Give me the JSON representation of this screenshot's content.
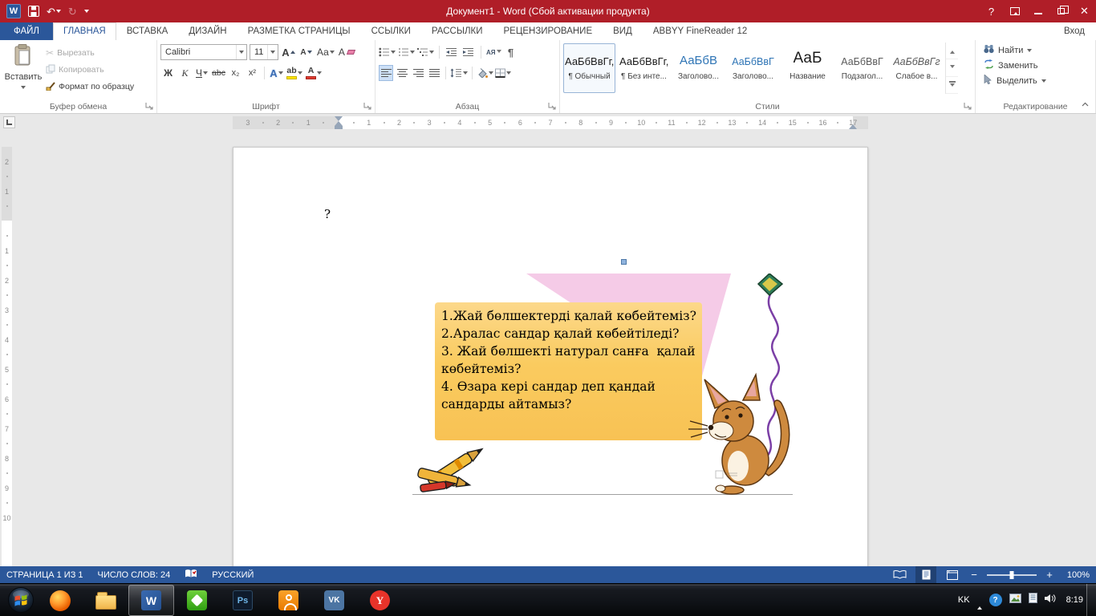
{
  "titlebar": {
    "title": "Документ1 -  Word (Сбой активации продукта)",
    "signin": "Вход"
  },
  "icons": {
    "undo": "↶",
    "redo": "↻",
    "close": "✕",
    "cut": "✂",
    "help": "?",
    "tray_help": "?"
  },
  "ribbon": {
    "tabs": [
      {
        "label": "ФАЙЛ",
        "class": "file"
      },
      {
        "label": "ГЛАВНАЯ",
        "class": "active"
      },
      {
        "label": "ВСТАВКА"
      },
      {
        "label": "ДИЗАЙН"
      },
      {
        "label": "РАЗМЕТКА СТРАНИЦЫ"
      },
      {
        "label": "ССЫЛКИ"
      },
      {
        "label": "РАССЫЛКИ"
      },
      {
        "label": "РЕЦЕНЗИРОВАНИЕ"
      },
      {
        "label": "ВИД"
      },
      {
        "label": "ABBYY FineReader 12"
      }
    ],
    "clipboard": {
      "label": "Буфер обмена",
      "paste": "Вставить",
      "cut": "Вырезать",
      "copy": "Копировать",
      "painter": "Формат по образцу"
    },
    "font": {
      "label": "Шрифт",
      "family": "Calibri",
      "size": "11",
      "grow": "А",
      "shrink": "А",
      "case": "Аа",
      "clear": "А",
      "bold": "Ж",
      "italic": "К",
      "underline": "Ч",
      "strike": "abc",
      "subscript": "х₂",
      "superscript": "х²",
      "effects": "А",
      "highlight": "ab",
      "color": "А"
    },
    "paragraph": {
      "label": "Абзац",
      "sort": "АЯ",
      "pilcrow": "¶"
    },
    "styles": {
      "label": "Стили",
      "items": [
        {
          "preview": "АаБбВвГг,",
          "name": "¶ Обычный",
          "class": "sel",
          "pclass": "p-normal"
        },
        {
          "preview": "АаБбВвГг,",
          "name": "¶ Без инте...",
          "pclass": "p-normal"
        },
        {
          "preview": "АаБбВ",
          "name": "Заголово...",
          "pclass": "p-h1"
        },
        {
          "preview": "АаБбВвГ",
          "name": "Заголово...",
          "pclass": "p-h2"
        },
        {
          "preview": "АаБ",
          "name": "Название",
          "pclass": "p-title"
        },
        {
          "preview": "АаБбВвГ",
          "name": "Подзагол...",
          "pclass": "p-sub"
        },
        {
          "preview": "АаБбВвГг",
          "name": "Слабое в...",
          "pclass": "p-emph"
        }
      ]
    },
    "editing": {
      "label": "Редактирование",
      "find": "Найти",
      "replace": "Заменить",
      "select": "Выделить"
    }
  },
  "ruler": {
    "h_marks": [
      "3",
      "2",
      "1",
      "",
      "1",
      "2",
      "3",
      "4",
      "5",
      "6",
      "7",
      "8",
      "9",
      "10",
      "11",
      "12",
      "13",
      "14",
      "15",
      "16",
      "17"
    ],
    "v_marks": [
      "2",
      "1",
      "",
      "1",
      "2",
      "3",
      "4",
      "5",
      "6",
      "7",
      "8",
      "9",
      "10"
    ]
  },
  "document": {
    "stray_text": "?",
    "question_box": [
      "1.Жай бөлшектерді қалай көбейтеміз?",
      "2.Аралас сандар қалай көбейтіледі?",
      "3. Жай бөлшекті натурал санға  қалай",
      "көбейтеміз?",
      "4. Өзара кері сандар деп қандай",
      "сандарды айтамыз?"
    ]
  },
  "statusbar": {
    "page_info": "СТРАНИЦА 1 ИЗ 1",
    "word_count": "ЧИСЛО СЛОВ: 24",
    "language": "РУССКИЙ",
    "zoom_minus": "−",
    "zoom_plus": "+",
    "zoom_level": "100%"
  },
  "taskbar": {
    "language": "KK",
    "time": "8:19",
    "word_letter": "W",
    "ps_label": "Ps",
    "vk_label": "VK",
    "yandex_letter": "Y"
  },
  "colors": {
    "titlebar_red": "#B01E28",
    "word_blue": "#2B579A",
    "heading_blue": "#2E74B5",
    "box_orange": "#FACB5F"
  }
}
